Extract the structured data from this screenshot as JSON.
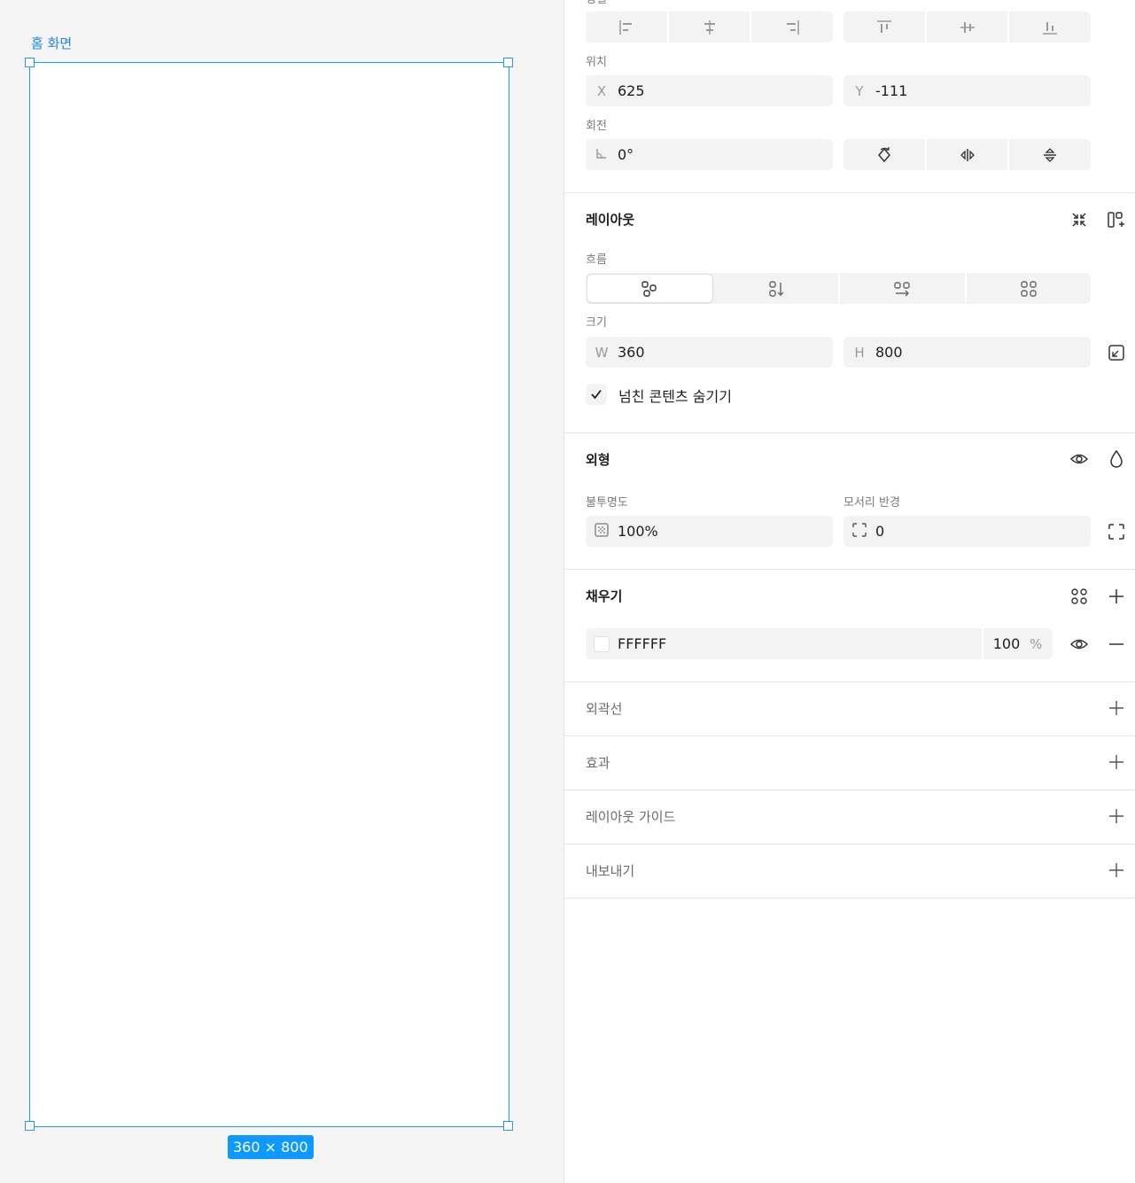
{
  "canvas": {
    "frame_name": "홈 화면",
    "size_badge": "360 × 800"
  },
  "panel": {
    "alignment": {
      "label": "정렬",
      "horizontal_icons": [
        "align-left-icon",
        "align-center-h-icon",
        "align-right-icon"
      ],
      "vertical_icons": [
        "align-top-icon",
        "align-middle-v-icon",
        "align-bottom-icon"
      ]
    },
    "position": {
      "label": "위치",
      "x_prefix": "X",
      "x_value": "625",
      "y_prefix": "Y",
      "y_value": "-111"
    },
    "rotation": {
      "label": "회전",
      "value": "0°"
    },
    "layout": {
      "title": "레이아웃",
      "flow_label": "흐름",
      "size_label": "크기",
      "w_prefix": "W",
      "w_value": "360",
      "h_prefix": "H",
      "h_value": "800",
      "clip_label": "넘친 콘텐츠 숨기기",
      "clip_checked": true
    },
    "appearance": {
      "title": "외형",
      "opacity_label": "불투명도",
      "opacity_value": "100%",
      "radius_label": "모서리 반경",
      "radius_value": "0"
    },
    "fill": {
      "title": "채우기",
      "hex": "FFFFFF",
      "opacity": "100",
      "unit": "%",
      "color": "#FFFFFF"
    },
    "sections": {
      "stroke": "외곽선",
      "effects": "효과",
      "layout_guide": "레이아웃 가이드",
      "export": "내보내기"
    }
  },
  "colors": {
    "accent": "#0d99ff",
    "selection": "#2196f3"
  }
}
